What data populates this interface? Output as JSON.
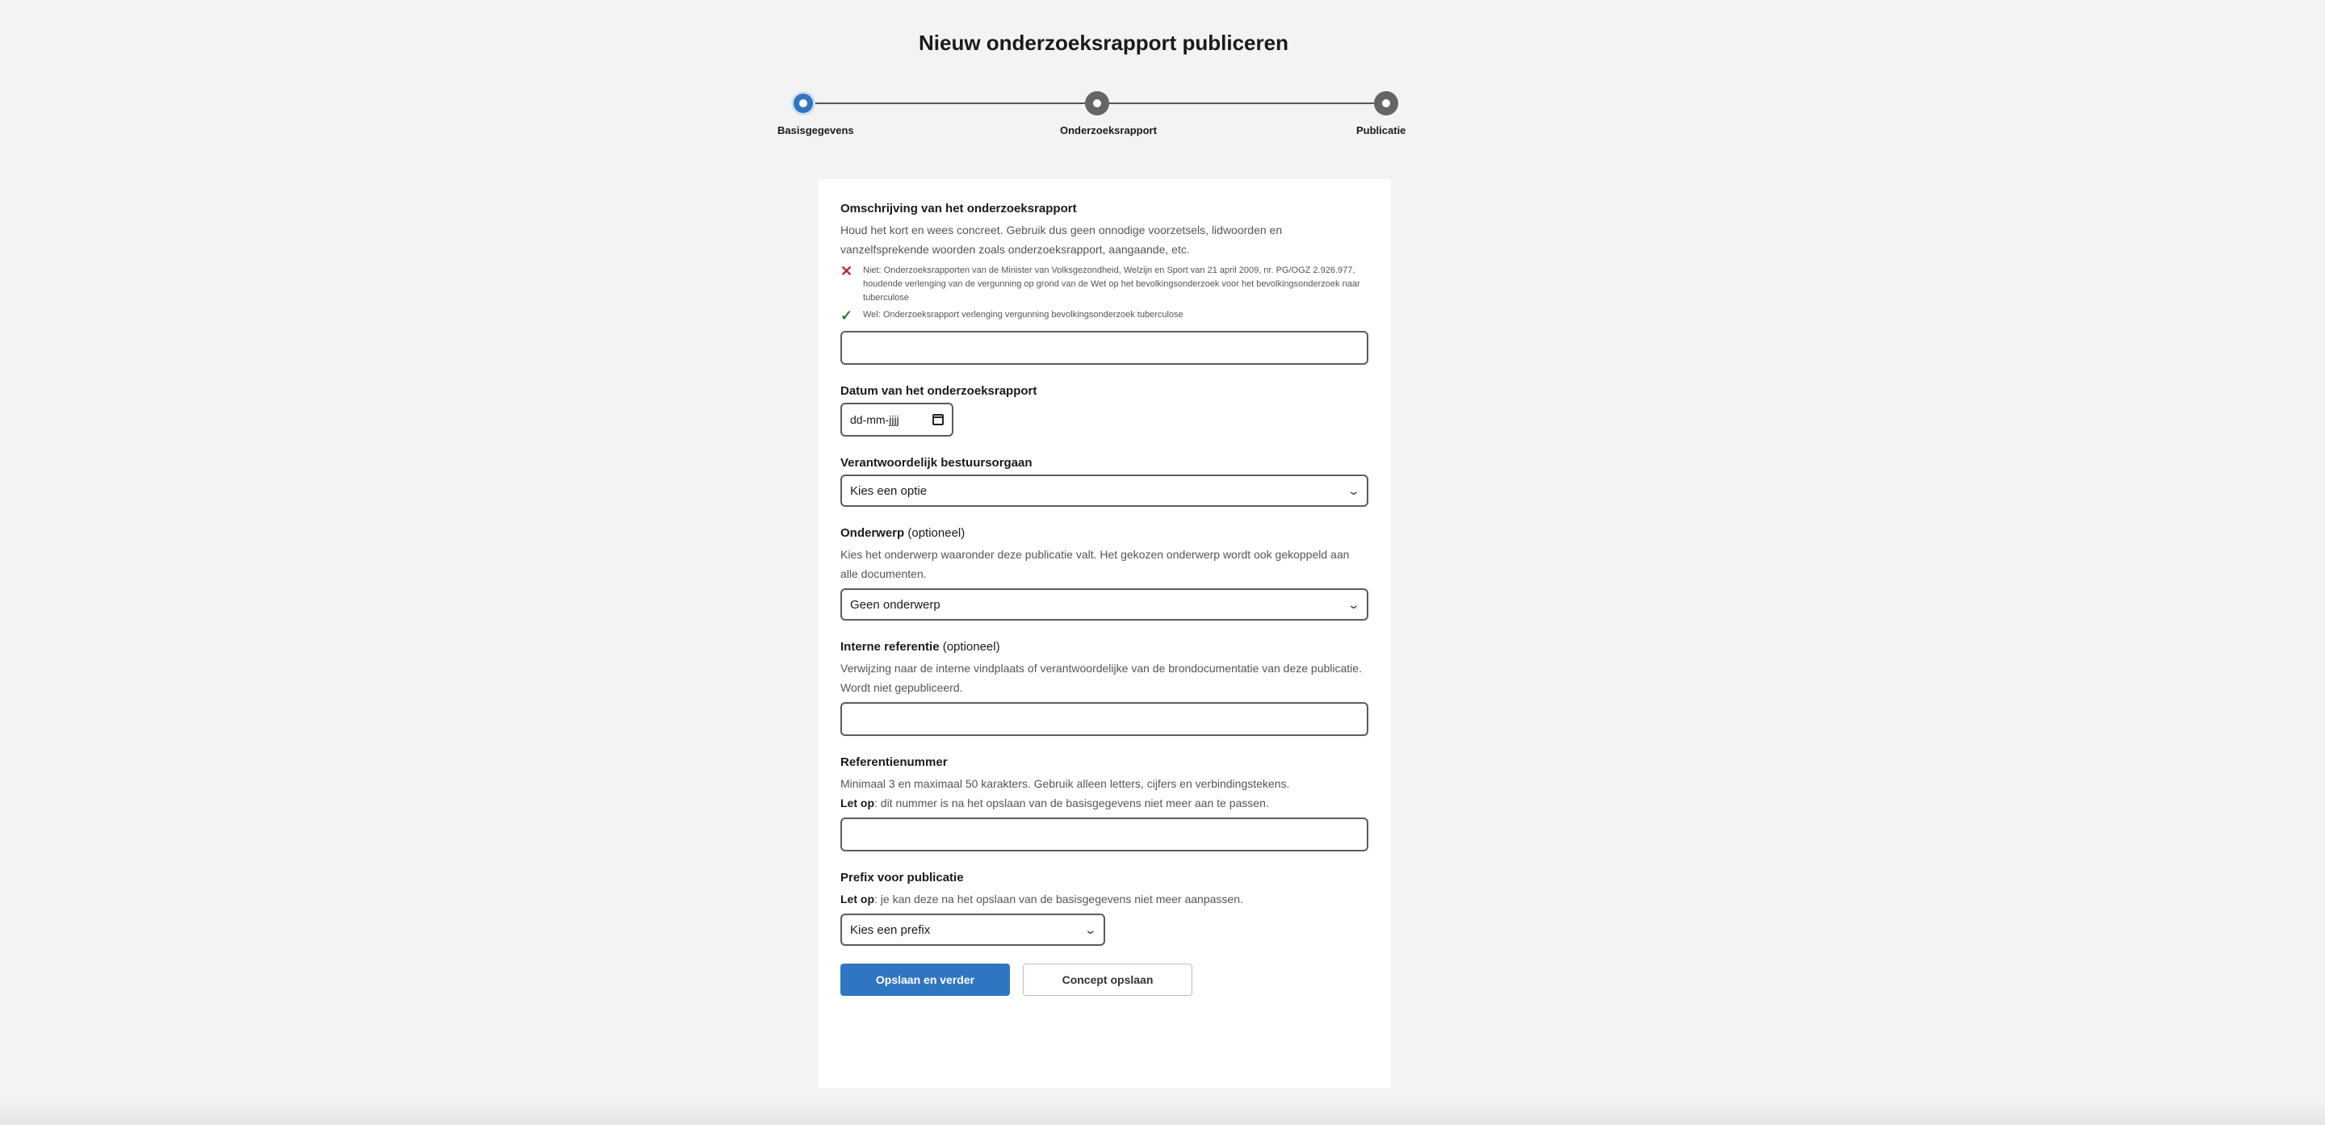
{
  "page": {
    "title": "Nieuw onderzoeksrapport publiceren"
  },
  "stepper": {
    "steps": [
      {
        "label": "Basisgegevens",
        "active": true
      },
      {
        "label": "Onderzoeksrapport",
        "active": false
      },
      {
        "label": "Publicatie",
        "active": false
      }
    ]
  },
  "form": {
    "omschrijving": {
      "label": "Omschrijving van het onderzoeksrapport",
      "help": "Houd het kort en wees concreet. Gebruik dus geen onnodige voorzetsels, lidwoorden en vanzelfsprekende woorden zoals onderzoeksrapport, aangaande, etc.",
      "bad_example": "Niet: Onderzoeksrapporten van de Minister van Volksgezondheid, Welzijn en Sport van 21 april 2009, nr. PG/OGZ 2.926.977, houdende verlenging van de vergunning op grond van de Wet op het bevolkingsonderzoek voor het bevolkingsonderzoek naar tuberculose",
      "good_example": "Wel: Onderzoeksrapport verlenging vergunning bevolkingsonderzoek tuberculose",
      "value": ""
    },
    "datum": {
      "label": "Datum van het onderzoeksrapport",
      "placeholder": "dd-mm-jjjj"
    },
    "bestuursorgaan": {
      "label": "Verantwoordelijk bestuursorgaan",
      "selected": "Kies een optie"
    },
    "onderwerp": {
      "label": "Onderwerp",
      "optional": "(optioneel)",
      "help": "Kies het onderwerp waaronder deze publicatie valt. Het gekozen onderwerp wordt ook gekoppeld aan alle documenten.",
      "selected": "Geen onderwerp"
    },
    "interne_referentie": {
      "label": "Interne referentie",
      "optional": "(optioneel)",
      "help": "Verwijzing naar de interne vindplaats of verantwoordelijke van de brondocumentatie van deze publicatie. Wordt niet gepubliceerd.",
      "value": ""
    },
    "referentienummer": {
      "label": "Referentienummer",
      "help": "Minimaal 3 en maximaal 50 karakters. Gebruik alleen letters, cijfers en verbindingstekens.",
      "note_bold": "Let op",
      "note": ": dit nummer is na het opslaan van de basisgegevens niet meer aan te passen.",
      "value": ""
    },
    "prefix": {
      "label": "Prefix voor publicatie",
      "note_bold": "Let op",
      "note": ": je kan deze na het opslaan van de basisgegevens niet meer aanpassen.",
      "selected": "Kies een prefix"
    },
    "buttons": {
      "save_next": "Opslaan en verder",
      "save_draft": "Concept opslaan"
    }
  },
  "colors": {
    "primary": "#2f76c2",
    "error": "#c0282d",
    "success": "#2e7d32"
  }
}
